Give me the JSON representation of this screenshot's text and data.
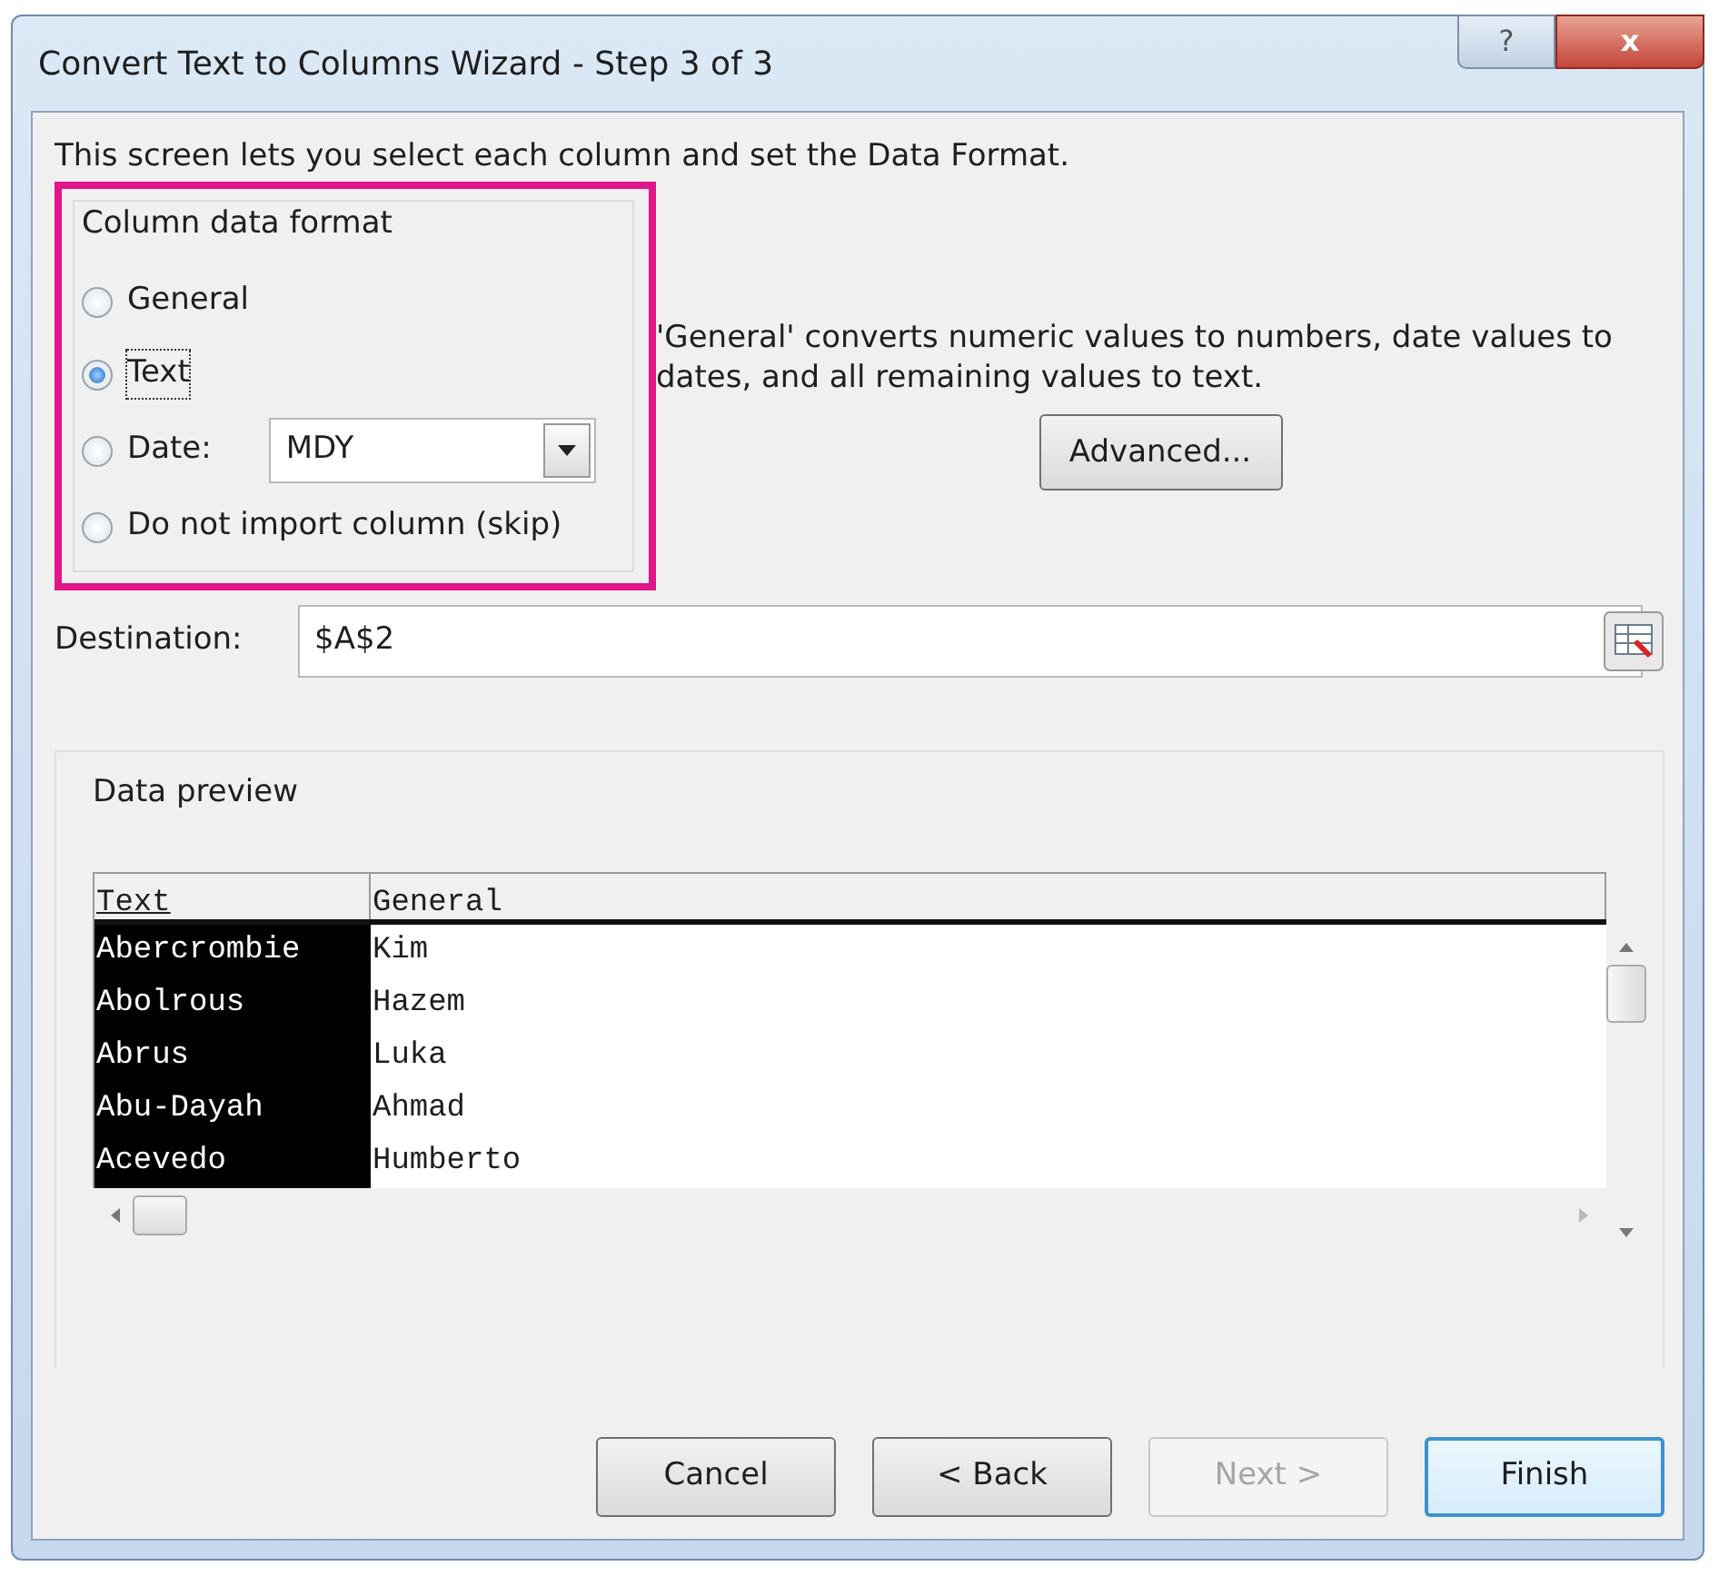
{
  "window": {
    "title": "Convert Text to Columns Wizard - Step 3 of 3",
    "help_button": "?",
    "close_button": "x"
  },
  "intro": "This screen lets you select each column and set the Data Format.",
  "format_group": {
    "title": "Column data format",
    "options": [
      {
        "kind": "radio",
        "label": "General",
        "selected": false
      },
      {
        "kind": "radio",
        "label": "Text",
        "selected": true
      },
      {
        "kind": "date",
        "label": "Date:",
        "selected": false,
        "value": "MDY"
      },
      {
        "kind": "radio",
        "label": "Do not import column (skip)",
        "selected": false
      }
    ]
  },
  "description": "'General' converts numeric values to numbers, date values to dates, and all remaining values to text.",
  "advanced_button": {
    "label": "Advanced..."
  },
  "destination": {
    "label": "Destination:",
    "value": "$A$2"
  },
  "preview": {
    "title": "Data preview",
    "columns": [
      {
        "label": "Text",
        "selected": true
      },
      {
        "label": "General",
        "selected": false
      }
    ],
    "rows": [
      [
        "Abercrombie",
        "Kim"
      ],
      [
        "Abolrous",
        "Hazem"
      ],
      [
        "Abrus",
        "Luka"
      ],
      [
        "Abu-Dayah",
        "Ahmad"
      ],
      [
        "Acevedo",
        "Humberto"
      ]
    ]
  },
  "buttons": [
    {
      "label": "Cancel",
      "disabled": false,
      "default": false
    },
    {
      "label": "< Back",
      "disabled": false,
      "default": false
    },
    {
      "label": "Next >",
      "disabled": true,
      "default": false
    },
    {
      "label": "Finish",
      "disabled": false,
      "default": true
    }
  ]
}
